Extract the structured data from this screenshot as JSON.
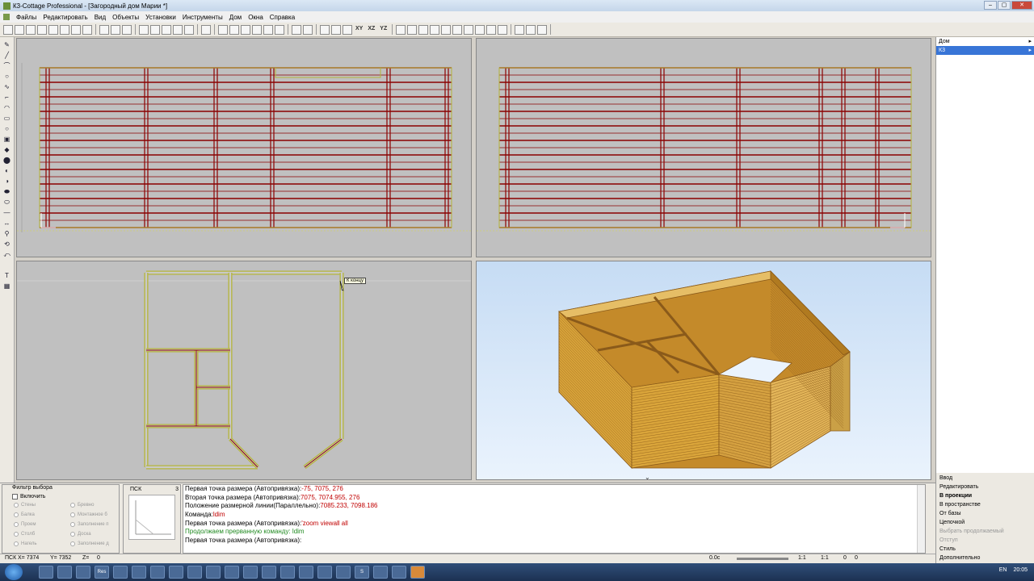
{
  "window": {
    "title": "К3-Cottage Professional - [Загородный дом Марии *]",
    "controls": [
      "–",
      "▢",
      "✕"
    ]
  },
  "menu": [
    "Файлы",
    "Редактировать",
    "Вид",
    "Объекты",
    "Установки",
    "Инструменты",
    "Дом",
    "Окна",
    "Справка"
  ],
  "toolbar": {
    "coord_buttons": [
      "XY",
      "XZ",
      "YZ"
    ]
  },
  "tooltip": "К концу",
  "right_panel": {
    "tree": [
      "Дом",
      "К3"
    ],
    "selected_index": 1,
    "commands": [
      "Ввод",
      "Редактировать",
      "В проекции",
      "В пространстве",
      "От базы",
      "Цепочкой",
      "Выбрать продолжаемый",
      "Отступ",
      "Стиль",
      "Дополнительно"
    ],
    "bold_index": 2,
    "disabled_indices": [
      6,
      7
    ]
  },
  "filter": {
    "title": "Фильтр выбора",
    "enable_label": "Включить",
    "options": [
      "Стены",
      "Бревно",
      "Балка",
      "Монтажное б",
      "Проем",
      "Заполнение п",
      "Столб",
      "Доска",
      "Нагель",
      "Заполнение д"
    ]
  },
  "psk": {
    "label": "ПСК",
    "number": "3"
  },
  "console": {
    "lines": [
      {
        "prompt": "Первая точка размера (Автопривязка):",
        "value": "-75, 7075, 276",
        "style": "normal"
      },
      {
        "prompt": "Вторая точка размера (Автопривязка):",
        "value": "7075, 7074.955, 276",
        "style": "normal"
      },
      {
        "prompt": "Положение размерной линии(Параллельно):",
        "value": "7085.233, 7098.186",
        "style": "normal"
      },
      {
        "prompt": "Команда:",
        "value": "ldim",
        "style": "normal"
      },
      {
        "prompt": "Первая точка размера (Автопривязка):",
        "value": "'zoom viewall all",
        "style": "normal"
      },
      {
        "prompt": "Продолжаем прерванную команду: ldim",
        "value": "",
        "style": "green"
      },
      {
        "prompt": "Первая точка размера (Автопривязка):",
        "value": "",
        "style": "normal"
      }
    ]
  },
  "status": {
    "psk_label": "ПСК",
    "x": "X= 7374",
    "y": "Y= 7352",
    "z": "Z=",
    "z_value": "0",
    "angle": "0.0с",
    "scale1": "1:1",
    "scale2": "1:1",
    "v1": "0",
    "v2": "0"
  },
  "taskbar": {
    "apps": [
      "",
      "",
      "",
      "Res",
      "",
      "",
      "",
      "",
      "",
      "",
      "",
      "",
      "",
      "",
      "",
      "",
      "",
      "S",
      "",
      "",
      ""
    ],
    "active_index": 20,
    "lang": "EN",
    "time": "20:05"
  },
  "colors": {
    "log_red": "#8b0000",
    "log_olive": "#b5b53a",
    "wood": "#d9a43a",
    "wood_dark": "#8a5a1a"
  }
}
